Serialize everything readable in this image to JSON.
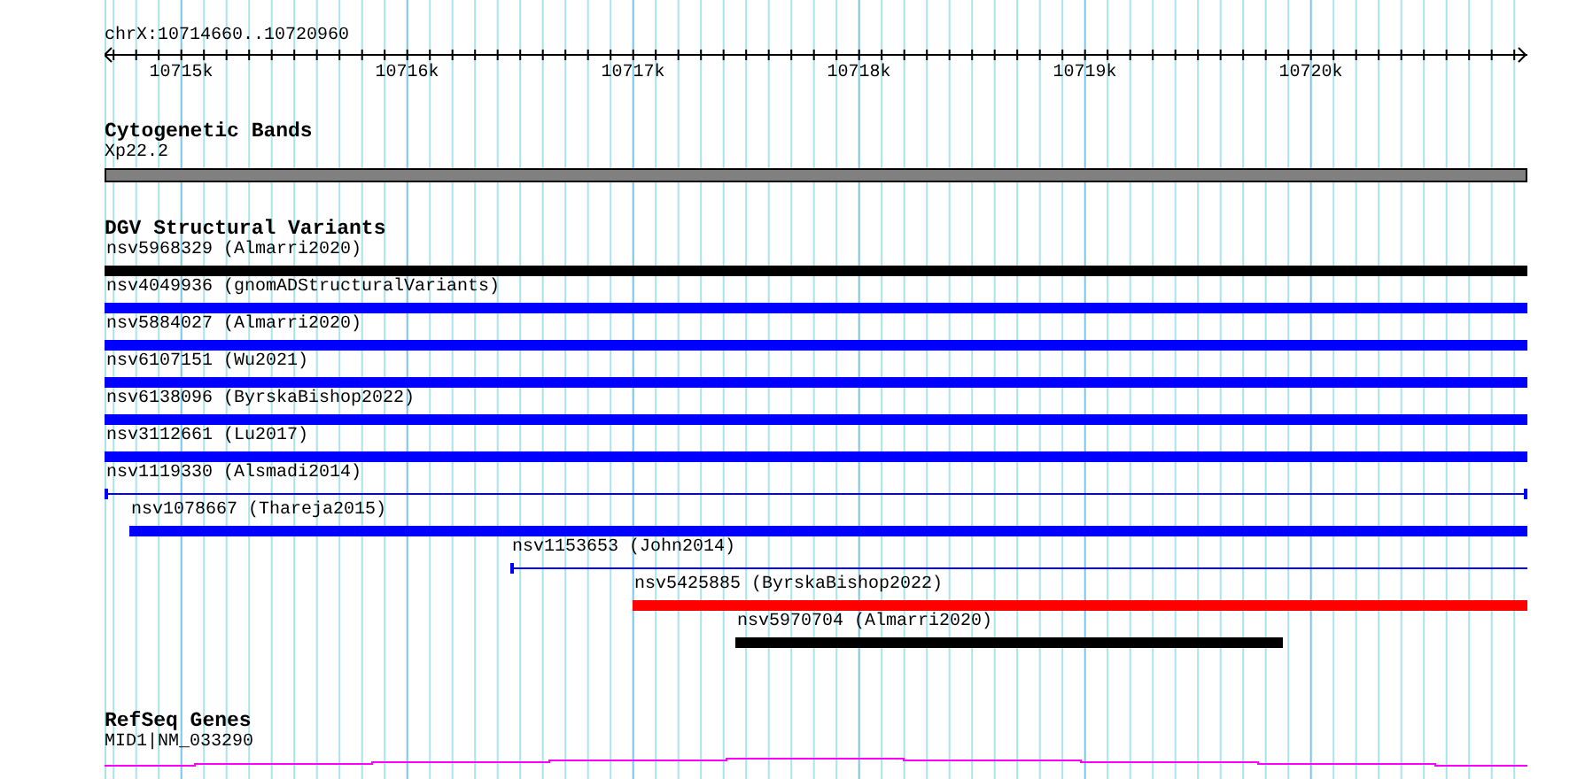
{
  "ruler": {
    "location": "chrX:10714660..10720960",
    "ticks": [
      "10715k",
      "10716k",
      "10717k",
      "10718k",
      "10719k",
      "10720k"
    ]
  },
  "tracks": [
    {
      "title": "Cytogenetic Bands",
      "kind": "bands",
      "features": [
        {
          "label": "Xp22.2"
        }
      ]
    },
    {
      "title": "DGV Structural Variants",
      "kind": "variants",
      "features": [
        {
          "label": "nsv5968329 (Almarri2020)",
          "kind": "thick",
          "color": "#000000"
        },
        {
          "label": "nsv4049936 (gnomADStructuralVariants)",
          "kind": "thick",
          "color": "#0000ff"
        },
        {
          "label": "nsv5884027 (Almarri2020)",
          "kind": "thick",
          "color": "#0000ff"
        },
        {
          "label": "nsv6107151 (Wu2021)",
          "kind": "thick",
          "color": "#0000ff"
        },
        {
          "label": "nsv6138096 (ByrskaBishop2022)",
          "kind": "thick",
          "color": "#0000ff"
        },
        {
          "label": "nsv3112661 (Lu2017)",
          "kind": "thick",
          "color": "#0000ff"
        },
        {
          "label": "nsv1119330 (Alsmadi2014)",
          "kind": "thin",
          "color": "#0000ff"
        },
        {
          "label": "nsv1078667 (Thareja2015)",
          "kind": "thick",
          "color": "#0000ff"
        },
        {
          "label": "nsv1153653 (John2014)",
          "kind": "thin",
          "color": "#0000ff"
        },
        {
          "label": "nsv5425885 (ByrskaBishop2022)",
          "kind": "thick",
          "color": "#ff0000"
        },
        {
          "label": "nsv5970704 (Almarri2020)",
          "kind": "thick",
          "color": "#000000"
        }
      ]
    },
    {
      "title": "RefSeq Genes",
      "kind": "genes",
      "features": [
        {
          "label": "MID1|NM_033290"
        }
      ]
    }
  ]
}
